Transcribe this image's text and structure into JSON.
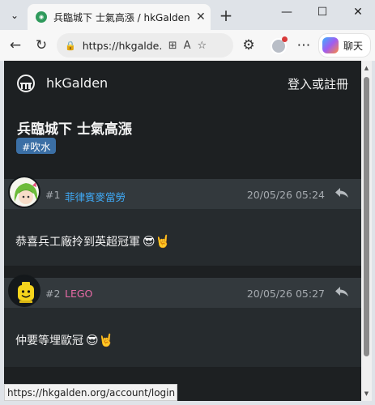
{
  "browser": {
    "tab_title": "兵臨城下 士氣高漲 / hkGalden 香港",
    "tab_favicon": "galden-favicon",
    "url": "https://hkgalde...",
    "copilot_label": "聊天",
    "status_url": "https://hkgalden.org/account/login"
  },
  "site": {
    "name": "hkGalden",
    "login_label": "登入或註冊"
  },
  "thread": {
    "title": "兵臨城下 士氣高漲",
    "tag": "#吹水"
  },
  "posts": [
    {
      "number": "#1",
      "username": "菲律賓麥當勞",
      "username_color": "#3fa9f5",
      "timestamp": "20/05/26 05:24",
      "text": "恭喜兵工廠拎到英超冠軍",
      "emoji": "😎🤘",
      "avatar": "green-hair-anime-avatar"
    },
    {
      "number": "#2",
      "username": "LEGO",
      "username_color": "#e86aa6",
      "timestamp": "20/05/26 05:27",
      "text": "仲要等埋歐冠",
      "emoji": "😎🤘",
      "avatar": "lego-head-avatar"
    }
  ],
  "colors": {
    "page_bg": "#1d2022",
    "post_header_bg": "#33393d",
    "tag_bg": "#3b6fa5"
  }
}
